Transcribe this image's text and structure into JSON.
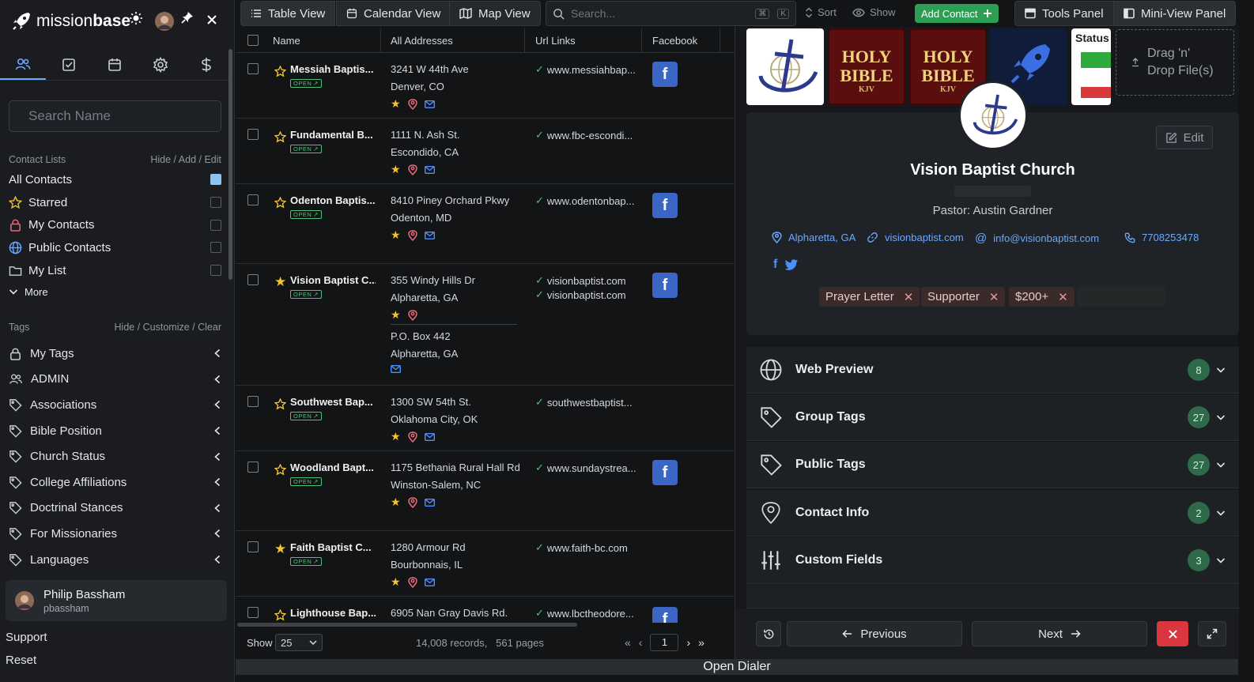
{
  "app": {
    "brand_prefix": "mission",
    "brand_suffix": "base"
  },
  "sidebar": {
    "search_placeholder": "Search Name",
    "contact_lists_label": "Contact Lists",
    "contact_lists_actions": "Hide / Add / Edit",
    "contact_lists": [
      {
        "label": "All Contacts",
        "checked": true,
        "icon": "none"
      },
      {
        "label": "Starred",
        "checked": false,
        "icon": "star-icon"
      },
      {
        "label": "My Contacts",
        "checked": false,
        "icon": "lock-icon"
      },
      {
        "label": "Public Contacts",
        "checked": false,
        "icon": "globe-icon"
      },
      {
        "label": "My List",
        "checked": false,
        "icon": "folder-icon"
      }
    ],
    "more_label": "More",
    "tags_label": "Tags",
    "tags_actions": "Hide / Customize / Clear",
    "tags": [
      {
        "label": "My Tags",
        "icon": "lock-icon"
      },
      {
        "label": "ADMIN",
        "icon": "users-icon"
      },
      {
        "label": "Associations",
        "icon": "tag-icon"
      },
      {
        "label": "Bible Position",
        "icon": "tag-icon"
      },
      {
        "label": "Church Status",
        "icon": "tag-icon"
      },
      {
        "label": "College Affiliations",
        "icon": "tag-icon"
      },
      {
        "label": "Doctrinal Stances",
        "icon": "tag-icon"
      },
      {
        "label": "For Missionaries",
        "icon": "tag-icon"
      },
      {
        "label": "Languages",
        "icon": "tag-icon"
      }
    ],
    "user": {
      "name": "Philip Bassham",
      "username": "pbassham"
    },
    "support_label": "Support",
    "reset_label": "Reset"
  },
  "toolbar": {
    "table_view": "Table View",
    "calendar_view": "Calendar View",
    "map_view": "Map View",
    "search_placeholder": "Search...",
    "kbd1": "⌘",
    "kbd2": "K",
    "sort_label": "Sort",
    "show_label": "Show",
    "add_contact_label": "Add Contact",
    "tools_panel_label": "Tools Panel",
    "mini_view_label": "Mini-View Panel"
  },
  "table": {
    "headers": {
      "name": "Name",
      "addresses": "All Addresses",
      "urls": "Url Links",
      "facebook": "Facebook"
    },
    "open_label": "OPEN",
    "rows": [
      {
        "name": "Messiah Baptis...",
        "starred": false,
        "addr1": "3241 W 44th Ave",
        "addr2": "Denver, CO",
        "url": "www.messiahbap...",
        "fb": true
      },
      {
        "name": "Fundamental B...",
        "starred": false,
        "addr1": "1111 N. Ash St.",
        "addr2": "Escondido, CA",
        "url": "www.fbc-escondi...",
        "fb": false
      },
      {
        "name": "Odenton Baptis...",
        "starred": false,
        "addr1": "8410 Piney Orchard Pkwy",
        "addr2": "Odenton, MD",
        "url": "www.odentonbap...",
        "fb": true
      },
      {
        "name": "Vision Baptist C...",
        "starred": true,
        "addr1": "355 Windy Hills Dr",
        "addr2": "Alpharetta, GA",
        "addr3": "P.O. Box 442",
        "addr4": "Alpharetta, GA",
        "url": "visionbaptist.com",
        "url2": "visionbaptist.com",
        "fb": true
      },
      {
        "name": "Southwest Bap...",
        "starred": false,
        "addr1": "1300 SW 54th St.",
        "addr2": "Oklahoma City, OK",
        "url": "southwestbaptist...",
        "fb": false
      },
      {
        "name": "Woodland Bapt...",
        "starred": false,
        "addr1": "1175 Bethania Rural Hall Rd",
        "addr2": "Winston-Salem, NC",
        "url": "www.sundaystrea...",
        "fb": true
      },
      {
        "name": "Faith Baptist C...",
        "starred": true,
        "addr1": "1280 Armour Rd",
        "addr2": "Bourbonnais, IL",
        "url": "www.faith-bc.com",
        "fb": false
      },
      {
        "name": "Lighthouse Bap...",
        "starred": false,
        "addr1": "6905 Nan Gray Davis Rd.",
        "url": "www.lbctheodore...",
        "fb": true
      }
    ],
    "show_label": "Show",
    "page_size": "25",
    "records_text": "14,008 records,   561 pages",
    "current_page": "1"
  },
  "detail": {
    "thumbnails": [
      "logo",
      "HOLY BIBLE KJV",
      "HOLY BIBLE KJV",
      "rocket",
      "Status"
    ],
    "thumb_bible_line1": "HOLY",
    "thumb_bible_line2": "BIBLE",
    "thumb_bible_line3": "KJV",
    "thumb_status": "Status",
    "dropzone_text": "Drag 'n' Drop File(s)",
    "edit_label": "Edit",
    "name": "Vision Baptist Church",
    "pastor": "Pastor: Austin Gardner",
    "location": "Alpharetta, GA",
    "website": "visionbaptist.com",
    "email": "info@visionbaptist.com",
    "phone": "7708253478",
    "tags": [
      "Prayer Letter",
      "Supporter",
      "$200+"
    ],
    "sections": [
      {
        "label": "Web Preview",
        "count": "8",
        "icon": "globe-icon"
      },
      {
        "label": "Group Tags",
        "count": "27",
        "icon": "tag-icon"
      },
      {
        "label": "Public Tags",
        "count": "27",
        "icon": "tag-icon"
      },
      {
        "label": "Contact Info",
        "count": "2",
        "icon": "map-pin-icon"
      },
      {
        "label": "Custom Fields",
        "count": "3",
        "icon": "sliders-icon"
      }
    ],
    "previous_label": "Previous",
    "next_label": "Next"
  },
  "dialer_label": "Open Dialer",
  "colors": {
    "accent": "#6aa9ff",
    "add_green": "#2f9e55",
    "count_badge": "#2e6a4a",
    "close_red": "#d9363e",
    "star": "#f4c430"
  }
}
